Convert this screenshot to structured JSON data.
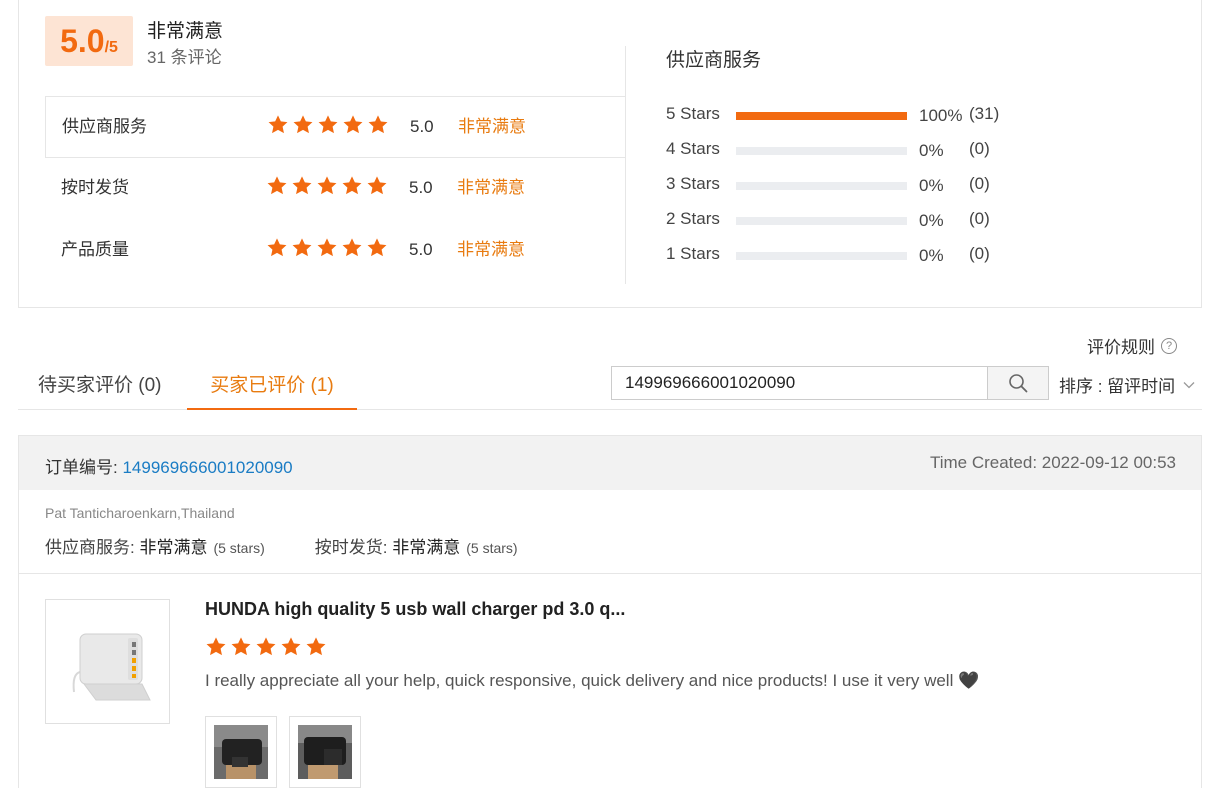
{
  "summary": {
    "score": "5.0",
    "score_suffix": "/5",
    "overall_label": "非常满意",
    "review_count": "31 条评论",
    "ratings": [
      {
        "label": "供应商服务",
        "stars": 5,
        "score": "5.0",
        "text": "非常满意"
      },
      {
        "label": "按时发货",
        "stars": 5,
        "score": "5.0",
        "text": "非常满意"
      },
      {
        "label": "产品质量",
        "stars": 5,
        "score": "5.0",
        "text": "非常满意"
      }
    ],
    "distribution_title": "供应商服务",
    "distribution": [
      {
        "label": "5  Stars",
        "percent": 100,
        "percent_text": "100%",
        "count": "(31)"
      },
      {
        "label": "4  Stars",
        "percent": 0,
        "percent_text": "0%",
        "count": "(0)"
      },
      {
        "label": "3  Stars",
        "percent": 0,
        "percent_text": "0%",
        "count": "(0)"
      },
      {
        "label": "2  Stars",
        "percent": 0,
        "percent_text": "0%",
        "count": "(0)"
      },
      {
        "label": "1  Stars",
        "percent": 0,
        "percent_text": "0%",
        "count": "(0)"
      }
    ]
  },
  "toolbar": {
    "rules_label": "评价规则",
    "tab_pending": "待买家评价 (0)",
    "tab_done": "买家已评价 (1)",
    "search_value": "149969666001020090",
    "sort_label": "排序 : 留评时间"
  },
  "order": {
    "no_label": "订单编号: ",
    "no_value": "149969666001020090",
    "time_created": "Time Created: 2022-09-12 00:53",
    "buyer": "Pat Tanticharoenkarn,Thailand",
    "buyer_ratings": [
      {
        "label": "供应商服务: ",
        "value": "非常满意",
        "sub": "(5 stars)"
      },
      {
        "label": "按时发货: ",
        "value": "非常满意",
        "sub": "(5 stars)"
      }
    ],
    "product_title": "HUNDA high quality 5 usb wall charger pd 3.0 q...",
    "product_stars": 5,
    "review_text": "I really appreciate all your help, quick responsive, quick delivery and nice products! I use it very well 🖤"
  },
  "colors": {
    "accent": "#f26a10",
    "link": "#1a7cc4",
    "rating_text": "#e87b10"
  }
}
